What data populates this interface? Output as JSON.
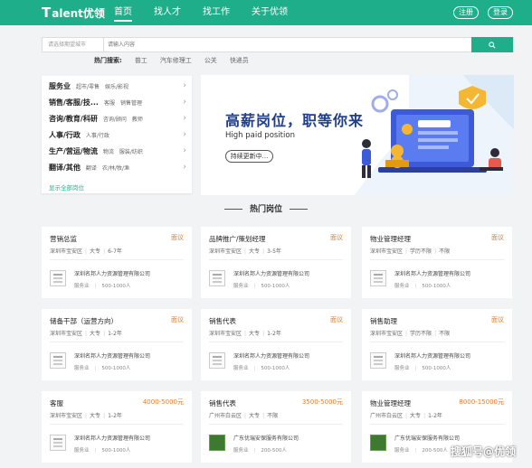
{
  "header": {
    "logo_mark": "T",
    "logo_text": "alent优领",
    "nav": [
      "首页",
      "找人才",
      "找工作",
      "关于优领"
    ],
    "register": "注册",
    "login": "登录"
  },
  "search": {
    "city_placeholder": "请选择期望城市",
    "keyword_placeholder": "请输入内容",
    "hot_label": "热门搜索:",
    "hot_terms": [
      "普工",
      "汽车修理工",
      "公关",
      "快递员"
    ]
  },
  "categories": [
    {
      "main": "服务业",
      "subs": [
        "超市/零售",
        "娱乐/影视"
      ]
    },
    {
      "main": "销售/客服/技...",
      "subs": [
        "客服",
        "销售管理"
      ]
    },
    {
      "main": "咨询/教育/科研",
      "subs": [
        "咨询/顾问",
        "教师"
      ]
    },
    {
      "main": "人事/行政",
      "subs": [
        "人事/行政"
      ]
    },
    {
      "main": "生产/营运/物流",
      "subs": [
        "物流",
        "服装/纺织"
      ]
    },
    {
      "main": "翻译/其他",
      "subs": [
        "翻译",
        "农/林/牧/渔"
      ]
    }
  ],
  "show_all": "显示全部岗位",
  "banner": {
    "title": "高薪岗位，职等你来",
    "subtitle": "High paid position",
    "button": "持续更新中..."
  },
  "section_title": "热门岗位",
  "jobs": [
    {
      "title": "营销总监",
      "salary": "面议",
      "loc": "深圳市宝安区",
      "edu": "大专",
      "exp": "6-7年",
      "company": "深圳名邦人力资源管理有限公司",
      "industry": "服务业",
      "size": "500-1000人",
      "photo": false
    },
    {
      "title": "品牌推广/策划经理",
      "salary": "面议",
      "loc": "深圳市宝安区",
      "edu": "大专",
      "exp": "3-5年",
      "company": "深圳名邦人力资源管理有限公司",
      "industry": "服务业",
      "size": "500-1000人",
      "photo": false
    },
    {
      "title": "物业管理经理",
      "salary": "面议",
      "loc": "深圳市宝安区",
      "edu": "学历不限",
      "exp": "不限",
      "company": "深圳名邦人力资源管理有限公司",
      "industry": "服务业",
      "size": "500-1000人",
      "photo": false
    },
    {
      "title": "储备干部（运营方向）",
      "salary": "面议",
      "loc": "深圳市宝安区",
      "edu": "大专",
      "exp": "1-2年",
      "company": "深圳名邦人力资源管理有限公司",
      "industry": "服务业",
      "size": "500-1000人",
      "photo": false
    },
    {
      "title": "销售代表",
      "salary": "面议",
      "loc": "深圳市宝安区",
      "edu": "大专",
      "exp": "1-2年",
      "company": "深圳名邦人力资源管理有限公司",
      "industry": "服务业",
      "size": "500-1000人",
      "photo": false
    },
    {
      "title": "销售助理",
      "salary": "面议",
      "loc": "深圳市宝安区",
      "edu": "学历不限",
      "exp": "不限",
      "company": "深圳名邦人力资源管理有限公司",
      "industry": "服务业",
      "size": "500-1000人",
      "photo": false
    },
    {
      "title": "客服",
      "salary": "4000-5000元",
      "loc": "深圳市宝安区",
      "edu": "大专",
      "exp": "1-2年",
      "company": "深圳名邦人力资源管理有限公司",
      "industry": "服务业",
      "size": "500-1000人",
      "photo": false
    },
    {
      "title": "销售代表",
      "salary": "3500-5000元",
      "loc": "广州市白云区",
      "edu": "大专",
      "exp": "不限",
      "company": "广东优瑞安保服务有限公司",
      "industry": "服务业",
      "size": "200-500人",
      "photo": true
    },
    {
      "title": "物业管理经理",
      "salary": "8000-15000元",
      "loc": "广州市白云区",
      "edu": "大专",
      "exp": "1-2年",
      "company": "广东优瑞安保服务有限公司",
      "industry": "服务业",
      "size": "200-500人",
      "photo": true
    }
  ],
  "watermark": "搜狐号@优领"
}
